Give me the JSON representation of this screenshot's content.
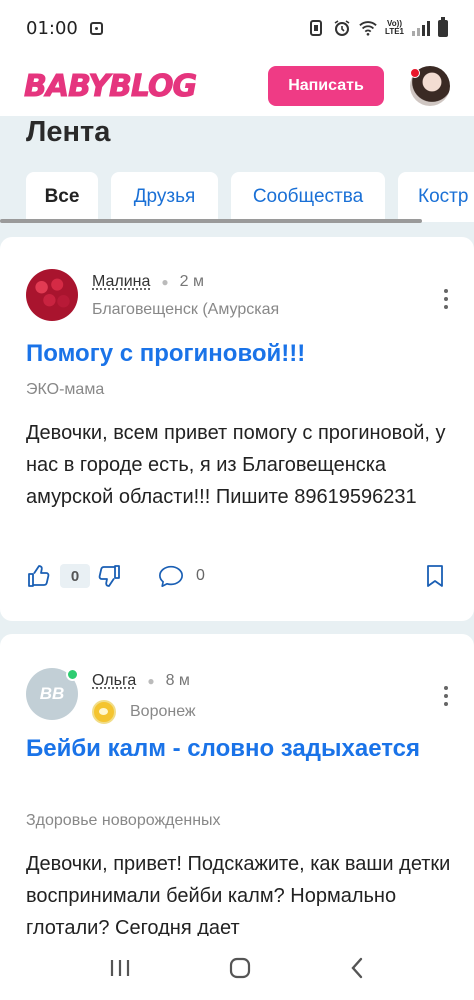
{
  "status": {
    "time": "01:00",
    "volte_top": "Vo))",
    "volte_bottom": "LTE1"
  },
  "header": {
    "logo": "BABYBLOG",
    "write_button": "Написать"
  },
  "feed": {
    "title": "Лента",
    "tabs": [
      "Все",
      "Друзья",
      "Сообщества",
      "Костр"
    ]
  },
  "posts": [
    {
      "author": "Малина",
      "time": "2 м",
      "location": "Благовещенск (Амурская",
      "title": "Помогу с прогиновой!!!",
      "category": "ЭКО-мама",
      "text": "Девочки, всем привет помогу с прогиновой, у нас в городе есть, я из Благовещенска амурской области!!! Пишите 89619596231",
      "likes": "0",
      "comments": "0"
    },
    {
      "author": "Ольга",
      "time": "8 м",
      "location": "Воронеж",
      "avatar_initials": "BB",
      "title": "Бейби калм - словно задыхается",
      "category": "Здоровье новорожденных",
      "text": "Девочки, привет! Подскажите, как ваши детки воспринимали бейби калм? Нормально глотали? Сегодня дает"
    }
  ],
  "colors": {
    "accent": "#ef3b85",
    "logo": "#e5357e",
    "link": "#1a73e8",
    "online": "#2ecc71"
  }
}
